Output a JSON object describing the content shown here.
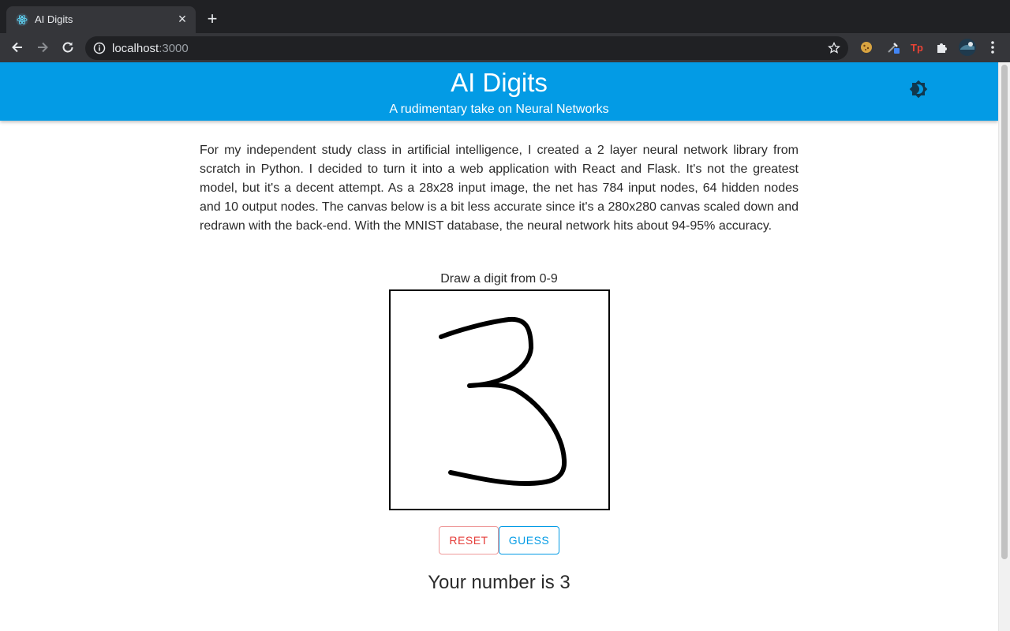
{
  "browser": {
    "tab_title": "AI Digits",
    "url_host": "localhost",
    "url_port": ":3000"
  },
  "header": {
    "title": "AI Digits",
    "subtitle": "A rudimentary take on Neural Networks"
  },
  "main": {
    "description": "For my independent study class in artificial intelligence, I created a 2 layer neural network library from scratch in Python. I decided to turn it into a web application with React and Flask. It's not the greatest model, but it's a decent attempt. As a 28x28 input image, the net has 784 input nodes, 64 hidden nodes and 10 output nodes. The canvas below is a bit less accurate since it's a 280x280 canvas scaled down and redrawn with the back-end. With the MNIST database, the neural network hits about 94-95% accuracy.",
    "canvas_label": "Draw a digit from 0-9",
    "reset_label": "RESET",
    "guess_label": "GUESS",
    "result": "Your number is 3"
  },
  "icons": {
    "theme_toggle": "brightness-icon",
    "tab_favicon": "react-icon"
  },
  "colors": {
    "appbar": "#039be5",
    "reset": "#e53935",
    "guess": "#039be5"
  }
}
